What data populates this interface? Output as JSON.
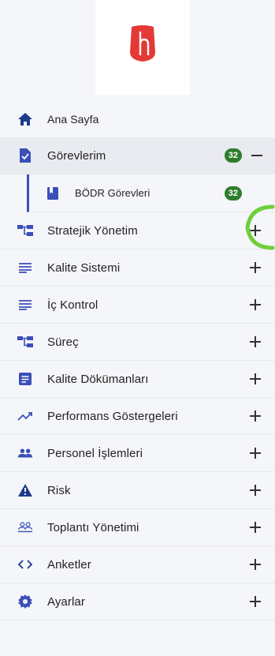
{
  "brand_color": "#e53935",
  "badge_color": "#2e7d2e",
  "nav": {
    "items": [
      {
        "label": "Ana Sayfa",
        "icon": "home-icon"
      },
      {
        "label": "Görevlerim",
        "icon": "task-document-icon",
        "badge": "32",
        "expanded": true
      },
      {
        "label": "BÖDR Görevleri",
        "icon": "bookmark-document-icon",
        "badge": "32"
      },
      {
        "label": "Stratejik Yönetim",
        "icon": "hierarchy-icon"
      },
      {
        "label": "Kalite Sistemi",
        "icon": "list-lines-icon"
      },
      {
        "label": "İç Kontrol",
        "icon": "list-lines-icon"
      },
      {
        "label": "Süreç",
        "icon": "hierarchy-icon"
      },
      {
        "label": "Kalite Dökümanları",
        "icon": "document-icon"
      },
      {
        "label": "Performans Göstergeleri",
        "icon": "trend-up-icon"
      },
      {
        "label": "Personel İşlemleri",
        "icon": "people-icon"
      },
      {
        "label": "Risk",
        "icon": "warning-icon"
      },
      {
        "label": "Toplantı Yönetimi",
        "icon": "meeting-people-icon"
      },
      {
        "label": "Anketler",
        "icon": "code-brackets-icon"
      },
      {
        "label": "Ayarlar",
        "icon": "gear-icon"
      }
    ]
  }
}
